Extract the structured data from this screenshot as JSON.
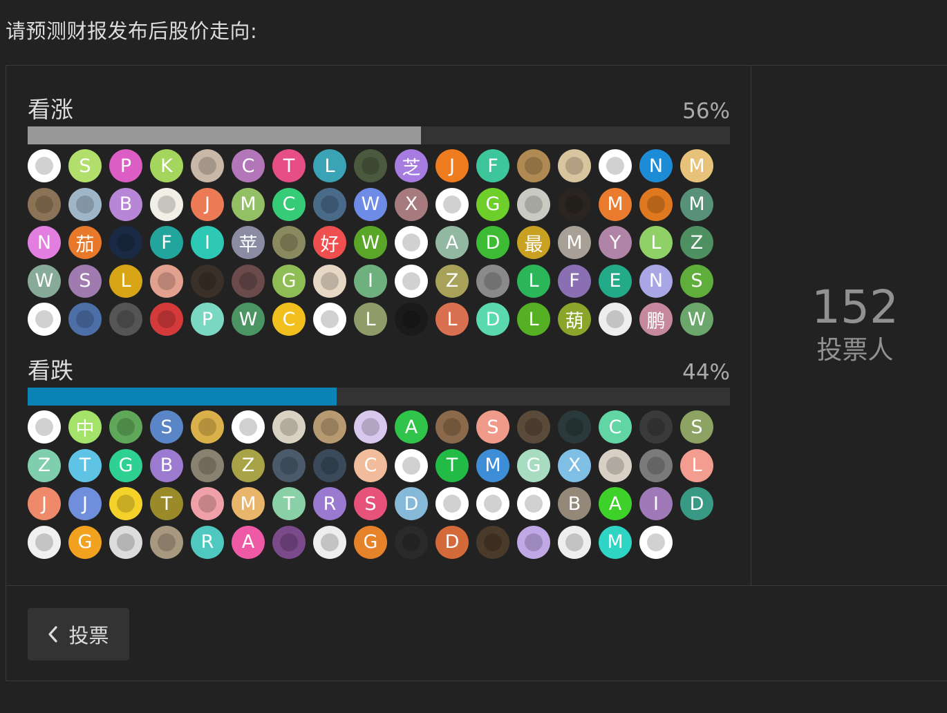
{
  "poll": {
    "question": "请预测财报发布后股价走向:",
    "total_count": "152",
    "total_label": "投票人",
    "vote_button_label": "投票"
  },
  "options": [
    {
      "label": "看涨",
      "percent_text": "56%",
      "percent": 56,
      "bar_color": "#999999",
      "voters": [
        {
          "kind": "icon",
          "icon": "rabbit-icon",
          "bg": "#ffffff"
        },
        {
          "text": "S",
          "bg": "#b2df6c"
        },
        {
          "text": "P",
          "bg": "#dc5dc3"
        },
        {
          "text": "K",
          "bg": "#a4d65e"
        },
        {
          "kind": "icon",
          "icon": "arale-avatar-icon",
          "bg": "#c9b8a8"
        },
        {
          "text": "C",
          "bg": "#b377b9"
        },
        {
          "text": "T",
          "bg": "#e64f85"
        },
        {
          "text": "L",
          "bg": "#3aa3b5"
        },
        {
          "kind": "icon",
          "icon": "photo-avatar-icon",
          "bg": "#4b5a3e"
        },
        {
          "text": "芝",
          "bg": "#a77ce0"
        },
        {
          "text": "J",
          "bg": "#ef7b1f"
        },
        {
          "text": "F",
          "bg": "#3ec69b"
        },
        {
          "kind": "icon",
          "icon": "cat-photo-icon",
          "bg": "#b08a52"
        },
        {
          "kind": "icon",
          "icon": "sketch-avatar-icon",
          "bg": "#d9c4a0"
        },
        {
          "kind": "icon",
          "icon": "weibo-icon",
          "bg": "#ffffff"
        },
        {
          "text": "N",
          "bg": "#1d8cd6"
        },
        {
          "text": "M",
          "bg": "#e8c27a"
        },
        {
          "kind": "icon",
          "icon": "dog-photo-icon",
          "bg": "#8b7355"
        },
        {
          "kind": "icon",
          "icon": "sign-photo-icon",
          "bg": "#9fb6c9"
        },
        {
          "text": "B",
          "bg": "#b786d6"
        },
        {
          "kind": "icon",
          "icon": "cartoon-avatar-icon",
          "bg": "#f2efe6"
        },
        {
          "text": "J",
          "bg": "#ec7a55"
        },
        {
          "text": "M",
          "bg": "#94c065"
        },
        {
          "text": "C",
          "bg": "#36cb77"
        },
        {
          "kind": "icon",
          "icon": "street-photo-icon",
          "bg": "#4a6a8a"
        },
        {
          "text": "W",
          "bg": "#6e8be6"
        },
        {
          "text": "X",
          "bg": "#a77a7e"
        },
        {
          "kind": "icon",
          "icon": "reddit-icon",
          "bg": "#ffffff"
        },
        {
          "text": "G",
          "bg": "#6fcf2a"
        },
        {
          "kind": "icon",
          "icon": "llama-photo-icon",
          "bg": "#c9cbc2"
        },
        {
          "kind": "icon",
          "icon": "portrait-photo-icon",
          "bg": "#2a2520"
        },
        {
          "text": "M",
          "bg": "#ea7b2e"
        },
        {
          "kind": "icon",
          "icon": "zhigu-logo-icon",
          "bg": "#e0781f"
        },
        {
          "text": "M",
          "bg": "#58917a"
        },
        {
          "text": "N",
          "bg": "#e27ee0"
        },
        {
          "text": "茄",
          "bg": "#e8792b"
        },
        {
          "kind": "icon",
          "icon": "bang-dream-icon",
          "bg": "#1a2a44"
        },
        {
          "text": "F",
          "bg": "#22a59d"
        },
        {
          "text": "I",
          "bg": "#2ec9b5"
        },
        {
          "text": "苹",
          "bg": "#8c8ba4"
        },
        {
          "kind": "icon",
          "icon": "pikachu-art-icon",
          "bg": "#8a8a60"
        },
        {
          "text": "好",
          "bg": "#ef4f4f"
        },
        {
          "text": "W",
          "bg": "#5aa629"
        },
        {
          "kind": "icon",
          "icon": "points-card-icon",
          "bg": "#ffffff"
        },
        {
          "text": "A",
          "bg": "#93b8a2"
        },
        {
          "text": "D",
          "bg": "#3dbb34"
        },
        {
          "text": "最",
          "bg": "#c8a022"
        },
        {
          "text": "M",
          "bg": "#a8a096"
        },
        {
          "text": "Y",
          "bg": "#b084a6"
        },
        {
          "text": "L",
          "bg": "#8fd167"
        },
        {
          "text": "Z",
          "bg": "#4e9060"
        },
        {
          "text": "W",
          "bg": "#87ab98"
        },
        {
          "text": "S",
          "bg": "#9f7bb0"
        },
        {
          "text": "L",
          "bg": "#d8a516"
        },
        {
          "kind": "icon",
          "icon": "anime-girl-icon",
          "bg": "#e2a08f"
        },
        {
          "kind": "icon",
          "icon": "centurion-photo-icon",
          "bg": "#3a3028"
        },
        {
          "kind": "icon",
          "icon": "fan-art-icon",
          "bg": "#6a4a4a"
        },
        {
          "text": "G",
          "bg": "#8fbd55"
        },
        {
          "kind": "icon",
          "icon": "pug-photo-icon",
          "bg": "#e6d8c5"
        },
        {
          "text": "I",
          "bg": "#6fb07f"
        },
        {
          "kind": "icon",
          "icon": "alibaba-logo-icon",
          "bg": "#ffffff"
        },
        {
          "text": "Z",
          "bg": "#a8a15a"
        },
        {
          "kind": "icon",
          "icon": "old-man-photo-icon",
          "bg": "#8a8a8a"
        },
        {
          "text": "L",
          "bg": "#2bb65a"
        },
        {
          "text": "F",
          "bg": "#8a6fb3"
        },
        {
          "text": "E",
          "bg": "#23aa88"
        },
        {
          "text": "N",
          "bg": "#a9a6e6"
        },
        {
          "text": "S",
          "bg": "#5fad3a"
        },
        {
          "kind": "icon",
          "icon": "sketch-figure-icon",
          "bg": "#ffffff"
        },
        {
          "kind": "icon",
          "icon": "anime-blue-hair-icon",
          "bg": "#4c6fa8"
        },
        {
          "kind": "icon",
          "icon": "man-glasses-photo-icon",
          "bg": "#555555"
        },
        {
          "kind": "icon",
          "icon": "clown-photo-icon",
          "bg": "#d43a3a"
        },
        {
          "text": "P",
          "bg": "#7ad7c1"
        },
        {
          "text": "W",
          "bg": "#4b9463"
        },
        {
          "text": "C",
          "bg": "#f2c01e"
        },
        {
          "kind": "icon",
          "icon": "superman-lego-icon",
          "bg": "#ffffff"
        },
        {
          "text": "L",
          "bg": "#8f9c6a"
        },
        {
          "kind": "icon",
          "icon": "colorful-circle-icon",
          "bg": "#1a1a1a"
        },
        {
          "text": "L",
          "bg": "#d9704f"
        },
        {
          "text": "D",
          "bg": "#5ad8ae"
        },
        {
          "text": "L",
          "bg": "#56b023"
        },
        {
          "text": "葫",
          "bg": "#8aa52a"
        },
        {
          "kind": "icon",
          "icon": "manga-boy-icon",
          "bg": "#eeeeee"
        },
        {
          "text": "鹏",
          "bg": "#c6889f"
        },
        {
          "text": "W",
          "bg": "#6ba66a"
        }
      ]
    },
    {
      "label": "看跌",
      "percent_text": "44%",
      "percent": 44,
      "bar_color": "#0b84b5",
      "voters": [
        {
          "kind": "icon",
          "icon": "goku-icon",
          "bg": "#ffffff"
        },
        {
          "text": "中",
          "bg": "#a3e36a"
        },
        {
          "kind": "icon",
          "icon": "pixel-game-icon",
          "bg": "#5fa85a"
        },
        {
          "text": "S",
          "bg": "#5a86c7"
        },
        {
          "kind": "icon",
          "icon": "gold-coin-icon",
          "bg": "#d9b04a"
        },
        {
          "kind": "icon",
          "icon": "orange-stack-icon",
          "bg": "#ffffff"
        },
        {
          "kind": "icon",
          "icon": "girl-drawing-icon",
          "bg": "#d9d2c2"
        },
        {
          "kind": "icon",
          "icon": "statue-photo-icon",
          "bg": "#b79a72"
        },
        {
          "kind": "icon",
          "icon": "anime-white-hair-icon",
          "bg": "#d9c8ee"
        },
        {
          "text": "A",
          "bg": "#30c44a"
        },
        {
          "kind": "icon",
          "icon": "woman-photo-icon",
          "bg": "#8a6a4a"
        },
        {
          "text": "S",
          "bg": "#ef9a8b"
        },
        {
          "kind": "icon",
          "icon": "city-photo-icon",
          "bg": "#5a4a3a"
        },
        {
          "kind": "icon",
          "icon": "man-dark-photo-icon",
          "bg": "#2a3a3a"
        },
        {
          "text": "C",
          "bg": "#62d5a5"
        },
        {
          "kind": "icon",
          "icon": "stage-photo-icon",
          "bg": "#3a3a3a"
        },
        {
          "text": "S",
          "bg": "#8da364"
        },
        {
          "text": "Z",
          "bg": "#7fcfaf"
        },
        {
          "text": "T",
          "bg": "#5fc3e6"
        },
        {
          "text": "G",
          "bg": "#2ed191"
        },
        {
          "text": "B",
          "bg": "#9b7ad0"
        },
        {
          "kind": "icon",
          "icon": "train-photo-icon",
          "bg": "#8a8270"
        },
        {
          "text": "Z",
          "bg": "#a8a347"
        },
        {
          "kind": "icon",
          "icon": "snow-photo-icon",
          "bg": "#4a5a6a"
        },
        {
          "kind": "icon",
          "icon": "poster-photo-icon",
          "bg": "#3a4a5a"
        },
        {
          "text": "C",
          "bg": "#f0bc9c"
        },
        {
          "kind": "icon",
          "icon": "fox-icon",
          "bg": "#ffffff"
        },
        {
          "text": "T",
          "bg": "#21bb46"
        },
        {
          "text": "M",
          "bg": "#3d8ed6"
        },
        {
          "text": "G",
          "bg": "#a8dcc0"
        },
        {
          "text": "X",
          "bg": "#7fbfe6"
        },
        {
          "kind": "icon",
          "icon": "kitten-photo-icon",
          "bg": "#d8d0c5"
        },
        {
          "kind": "icon",
          "icon": "cat-bed-photo-icon",
          "bg": "#7a7a7a"
        },
        {
          "text": "L",
          "bg": "#f39c90"
        },
        {
          "text": "J",
          "bg": "#ee8a6a"
        },
        {
          "text": "J",
          "bg": "#6f8fdc"
        },
        {
          "kind": "icon",
          "icon": "big-bird-icon",
          "bg": "#f5d22a"
        },
        {
          "text": "T",
          "bg": "#9a8a2a"
        },
        {
          "kind": "icon",
          "icon": "sticker-icon",
          "bg": "#f0a0a8"
        },
        {
          "text": "M",
          "bg": "#e8b56a"
        },
        {
          "text": "T",
          "bg": "#8ad0a6"
        },
        {
          "text": "R",
          "bg": "#9a7ad0"
        },
        {
          "text": "S",
          "bg": "#e6527a"
        },
        {
          "text": "D",
          "bg": "#86b8d8"
        },
        {
          "kind": "icon",
          "icon": "doraemon-icon",
          "bg": "#ffffff"
        },
        {
          "kind": "icon",
          "icon": "sakura-icon",
          "bg": "#ffffff"
        },
        {
          "kind": "icon",
          "icon": "ghost-drawing-icon",
          "bg": "#ffffff"
        },
        {
          "text": "B",
          "bg": "#948878"
        },
        {
          "text": "A",
          "bg": "#3ed12a"
        },
        {
          "text": "I",
          "bg": "#a07ab8"
        },
        {
          "text": "D",
          "bg": "#389a84"
        },
        {
          "kind": "icon",
          "icon": "meme-face-icon",
          "bg": "#f0f0f0"
        },
        {
          "text": "G",
          "bg": "#f2a21e"
        },
        {
          "kind": "icon",
          "icon": "anime-detective-icon",
          "bg": "#dcdcdc"
        },
        {
          "kind": "icon",
          "icon": "dog-outdoor-photo-icon",
          "bg": "#a89880"
        },
        {
          "text": "R",
          "bg": "#4fc9c0"
        },
        {
          "text": "A",
          "bg": "#ee5aa6"
        },
        {
          "kind": "icon",
          "icon": "anime-horse-girl-icon",
          "bg": "#7a4a8a"
        },
        {
          "kind": "icon",
          "icon": "manga-girl-icon",
          "bg": "#eeeeee"
        },
        {
          "text": "G",
          "bg": "#e6822a"
        },
        {
          "kind": "icon",
          "icon": "eye-closeup-icon",
          "bg": "#2a2a2a"
        },
        {
          "text": "D",
          "bg": "#d46a3a"
        },
        {
          "kind": "icon",
          "icon": "forest-photo-icon",
          "bg": "#4a3a2a"
        },
        {
          "kind": "icon",
          "icon": "anime-purple-hair-icon",
          "bg": "#c0a8e6"
        },
        {
          "kind": "icon",
          "icon": "conan-icon",
          "bg": "#eeeeee"
        },
        {
          "text": "M",
          "bg": "#2ed4c4"
        },
        {
          "kind": "icon",
          "icon": "tap-portugal-logo-icon",
          "bg": "#ffffff"
        }
      ]
    }
  ]
}
